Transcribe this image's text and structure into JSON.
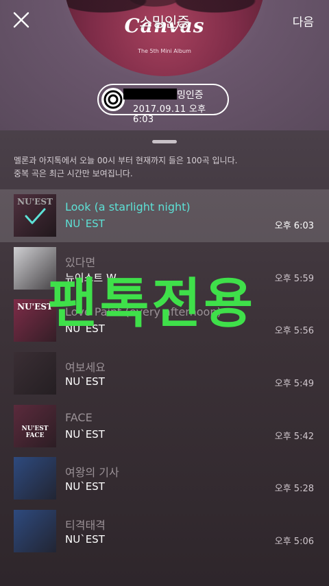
{
  "header": {
    "title": "스밍인증",
    "next_label": "다음",
    "album": {
      "title": "Canvas",
      "subtitle": "The 5th Mini Album"
    }
  },
  "badge": {
    "label": "밍인증",
    "datetime": "2017.09.11 오후 6:03"
  },
  "info": {
    "line1": "멜론과 아지톡에서 오늘 00시 부터 현재까지 들은 100곡 입니다.",
    "line2": "중복 곡은 최근 시간만 보여집니다."
  },
  "songs": [
    {
      "title": "Look (a starlight night)",
      "artist": "NU`EST",
      "time": "오후 6:03",
      "thumb_text": "NU'EST",
      "thumb_color": "#7a4b60"
    },
    {
      "title": "있다면",
      "artist": "뉴이스트 W",
      "time": "오후 5:59",
      "thumb_text": "",
      "thumb_color": "#cfcfd2"
    },
    {
      "title": "Love Paint (every afternoon)",
      "artist": "NU`EST",
      "time": "오후 5:56",
      "thumb_text": "NU'EST",
      "thumb_color": "#7e2c48"
    },
    {
      "title": "여보세요",
      "artist": "NU`EST",
      "time": "오후 5:49",
      "thumb_text": "",
      "thumb_color": "#3a2e34"
    },
    {
      "title": "FACE",
      "artist": "NU`EST",
      "time": "오후 5:42",
      "thumb_text": "NU'EST FACE",
      "thumb_color": "#5b2a3c"
    },
    {
      "title": "여왕의 기사",
      "artist": "NU`EST",
      "time": "오후 5:28",
      "thumb_text": "",
      "thumb_color": "#2e4a7e"
    },
    {
      "title": "티격태격",
      "artist": "NU`EST",
      "time": "오후 5:06",
      "thumb_text": "",
      "thumb_color": "#2e4a7e"
    }
  ],
  "watermark": "팬톡전용",
  "colors": {
    "accent": "#5de1d6",
    "watermark": "#3fe04a"
  }
}
